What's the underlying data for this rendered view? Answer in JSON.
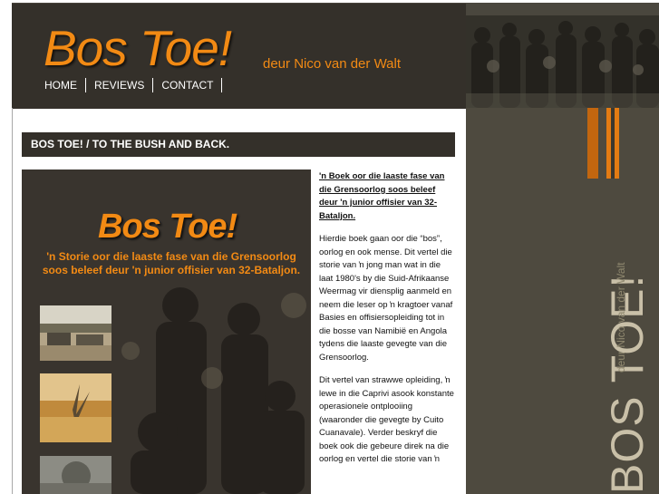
{
  "header": {
    "logo_title": "Bos Toe!",
    "logo_subtitle": "deur Nico van der Walt",
    "nav": [
      {
        "label": "HOME"
      },
      {
        "label": "REVIEWS"
      },
      {
        "label": "CONTACT"
      }
    ]
  },
  "sidebar": {
    "vertical_title": "BOS TOE!",
    "vertical_subtitle": "deur Nico van der Walt"
  },
  "main": {
    "page_title": "BOS TOE! / TO THE BUSH AND BACK.",
    "cover": {
      "title": "Bos Toe!",
      "subtitle": "'n Storie oor die laaste fase van die Grensoorlog soos beleef deur 'n junior offisier van 32-Bataljon."
    },
    "intro": "'n Boek oor die laaste fase van die Grensoorlog soos beleef deur 'n junior offisier van 32-Bataljon.",
    "paragraphs": [
      "Hierdie boek gaan oor die “bos”, oorlog en ook mense. Dit vertel die storie van ŉ jong man wat in die laat 1980's by die Suid-Afrikaanse Weermag vir diensplig aanmeld en neem die leser op ŉ kragtoer vanaf Basies en offisiersopleiding tot in die bosse van Namibië en Angola tydens die laaste gevegte van die Grensoorlog.",
      "Dit vertel van strawwe opleiding, ŉ lewe in die Caprivi asook konstante operasionele ontplooiing (waaronder die gevegte by Cuito Cuanavale). Verder beskryf die boek ook die gebeure direk na die oorlog en vertel die storie van ŉ"
    ]
  },
  "colors": {
    "accent_orange": "#f28a14",
    "header_dark": "#34302a",
    "sidebar_olive": "#4e4a3f"
  }
}
